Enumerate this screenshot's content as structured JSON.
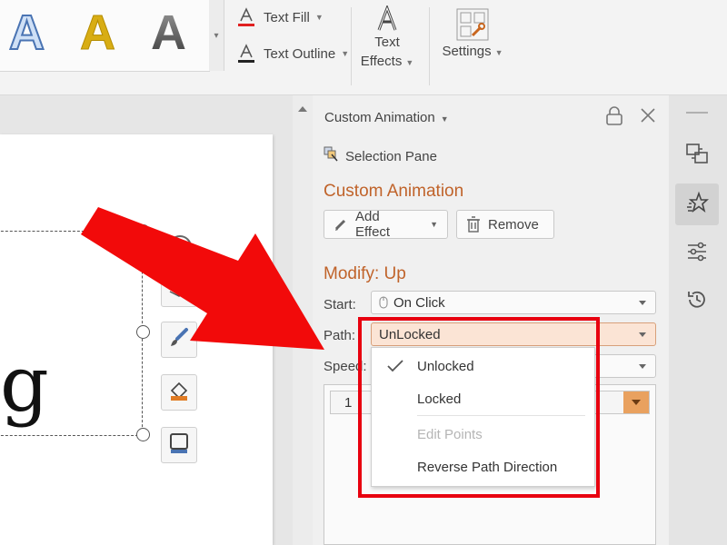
{
  "ribbon": {
    "wordart_letters": [
      "A",
      "A",
      "A"
    ],
    "text_fill_label": "Text Fill",
    "text_outline_label": "Text Outline",
    "text_effects_label_line1": "Text",
    "text_effects_label_line2": "Effects",
    "settings_label": "Settings",
    "icons": [
      "text-fill-icon",
      "text-outline-icon",
      "text-effects-icon",
      "settings-icon"
    ]
  },
  "document": {
    "visible_glyph": "g",
    "float_tools": [
      "layers-icon",
      "brush-icon",
      "fill-icon",
      "border-icon"
    ]
  },
  "pane": {
    "title": "Custom Animation",
    "selection_pane_label": "Selection Pane",
    "section_title": "Custom Animation",
    "add_effect_label": "Add Effect",
    "remove_label": "Remove",
    "modify_title": "Modify: Up",
    "start_label": "Start:",
    "start_value": "On Click",
    "path_label": "Path:",
    "path_value": "UnLocked",
    "speed_label": "Speed:",
    "list_item_number": "1"
  },
  "dropdown": {
    "items": [
      {
        "label": "Unlocked",
        "checked": true,
        "disabled": false
      },
      {
        "label": "Locked",
        "checked": false,
        "disabled": false
      },
      {
        "label": "Edit Points",
        "checked": false,
        "disabled": true
      },
      {
        "label": "Reverse Path Direction",
        "checked": false,
        "disabled": false
      }
    ]
  },
  "rail": {
    "icons": [
      "switch-icon",
      "animation-star-icon",
      "properties-icon",
      "history-icon"
    ]
  },
  "colors": {
    "accent_orange": "#c0632a",
    "annotation_red": "#e8000f",
    "path_highlight": "#fbe4d5"
  }
}
